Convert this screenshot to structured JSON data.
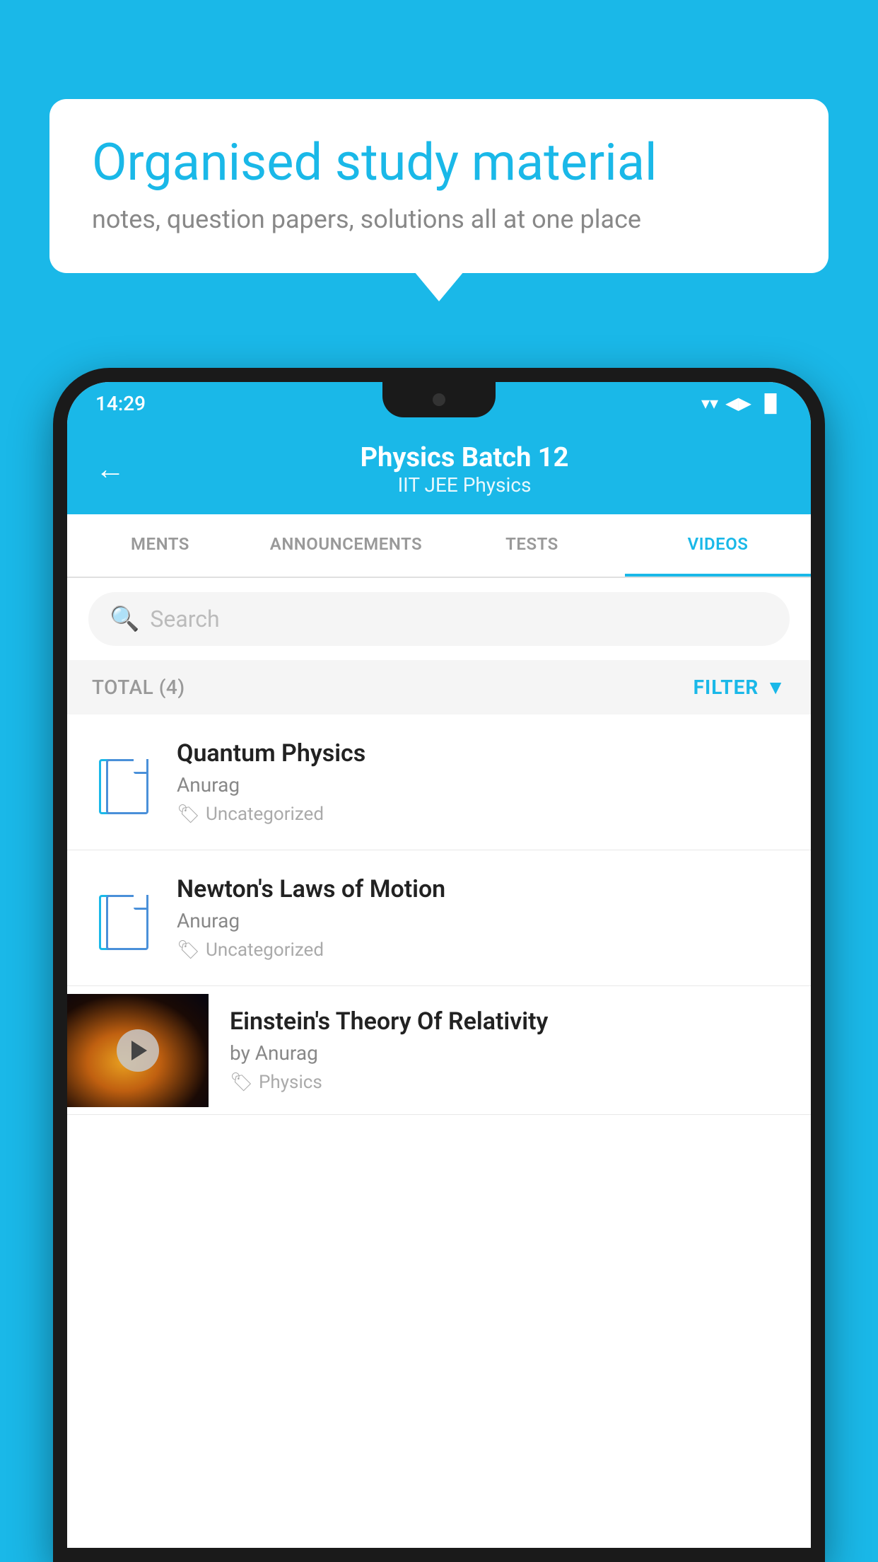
{
  "background_color": "#1ab8e8",
  "speech_bubble": {
    "headline": "Organised study material",
    "subtext": "notes, question papers, solutions all at one place"
  },
  "phone": {
    "status_bar": {
      "time": "14:29",
      "wifi": "▲",
      "signal": "▲",
      "battery": "▐"
    },
    "header": {
      "title": "Physics Batch 12",
      "subtitle": "IIT JEE   Physics",
      "back_label": "←"
    },
    "tabs": [
      {
        "label": "MENTS",
        "active": false
      },
      {
        "label": "ANNOUNCEMENTS",
        "active": false
      },
      {
        "label": "TESTS",
        "active": false
      },
      {
        "label": "VIDEOS",
        "active": true
      }
    ],
    "search": {
      "placeholder": "Search"
    },
    "filter_row": {
      "total_label": "TOTAL (4)",
      "filter_label": "FILTER"
    },
    "videos": [
      {
        "title": "Quantum Physics",
        "author": "Anurag",
        "tag": "Uncategorized",
        "has_thumbnail": false
      },
      {
        "title": "Newton's Laws of Motion",
        "author": "Anurag",
        "tag": "Uncategorized",
        "has_thumbnail": false
      },
      {
        "title": "Einstein's Theory Of Relativity",
        "author": "by Anurag",
        "tag": "Physics",
        "has_thumbnail": true
      }
    ]
  }
}
